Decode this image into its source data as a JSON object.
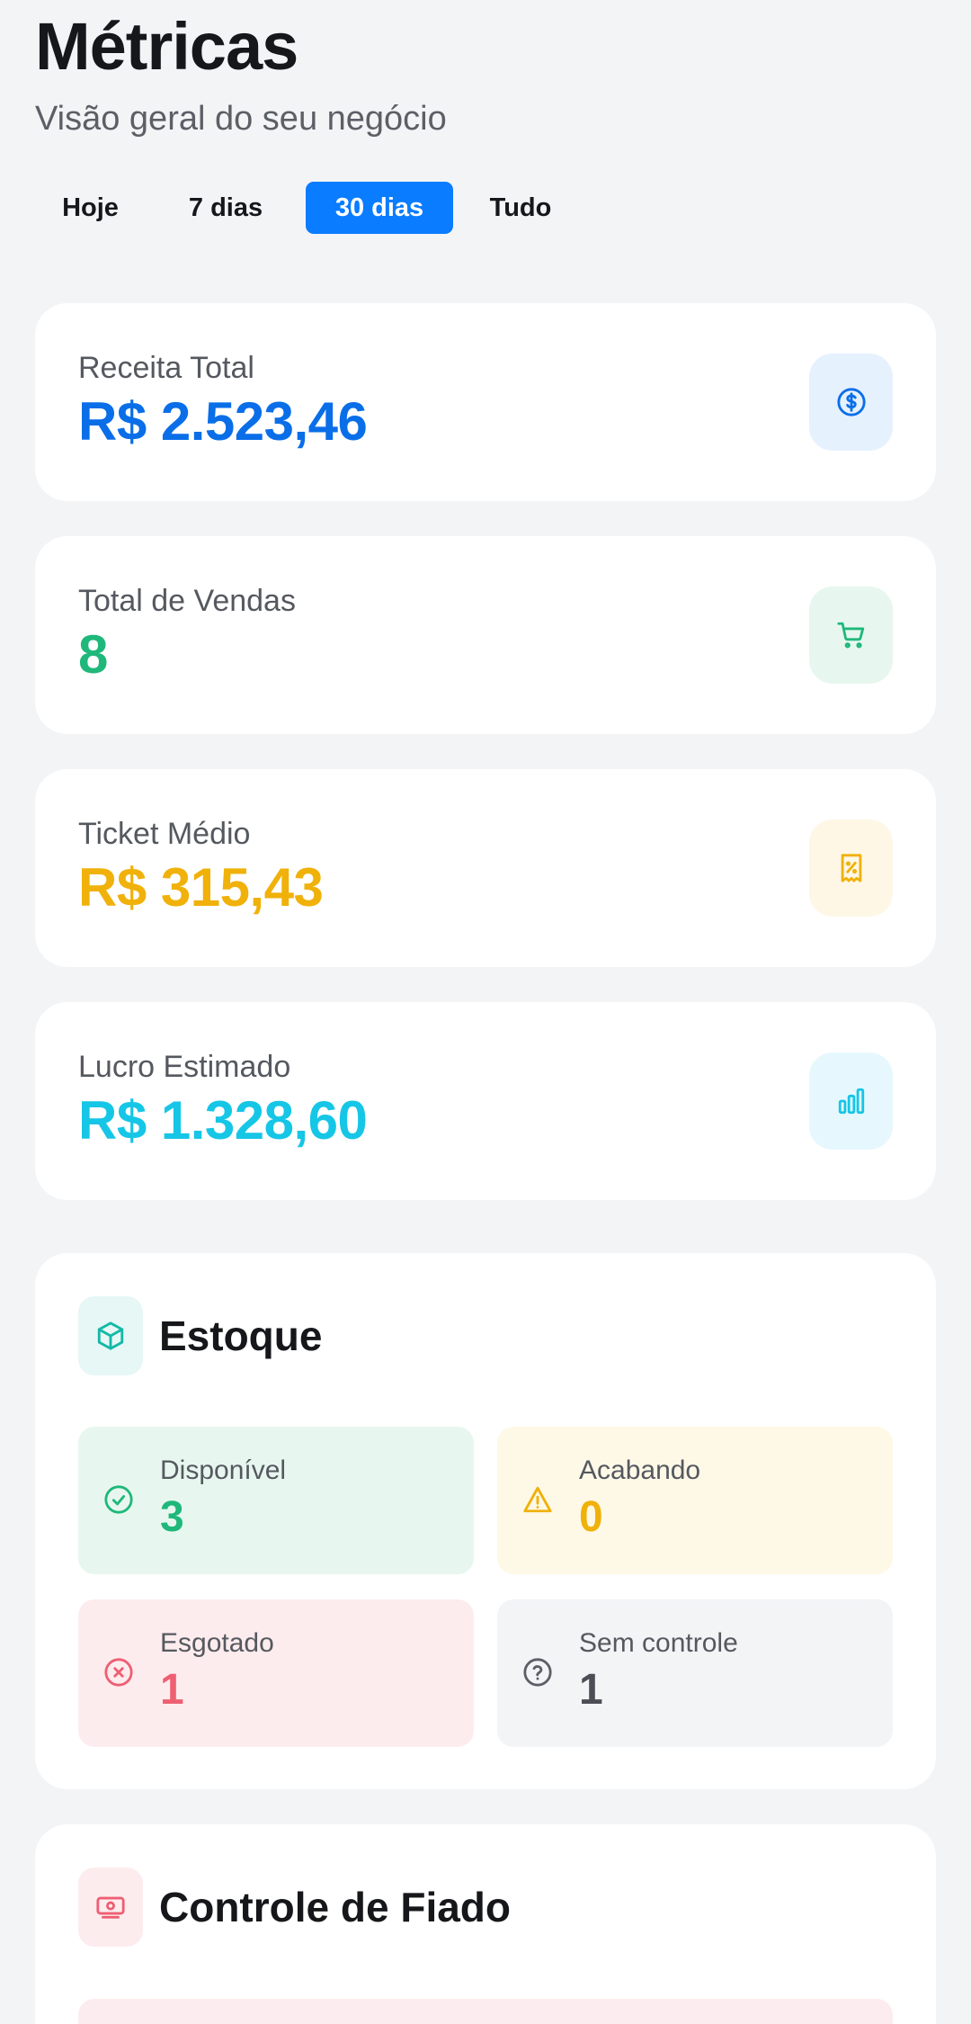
{
  "header": {
    "title": "Métricas",
    "subtitle": "Visão geral do seu negócio"
  },
  "period_tabs": [
    {
      "label": "Hoje",
      "active": false
    },
    {
      "label": "7 dias",
      "active": false
    },
    {
      "label": "30 dias",
      "active": true
    },
    {
      "label": "Tudo",
      "active": false
    }
  ],
  "metrics": [
    {
      "label": "Receita Total",
      "value": "R$ 2.523,46",
      "color": "#0a6ee8",
      "icon": "dollar-icon",
      "icon_bg": "#e6f1fe",
      "icon_color": "#0a6ee8"
    },
    {
      "label": "Total de Vendas",
      "value": "8",
      "color": "#1fb87a",
      "icon": "cart-icon",
      "icon_bg": "#e7f7ef",
      "icon_color": "#1fb87a"
    },
    {
      "label": "Ticket Médio",
      "value": "R$ 315,43",
      "color": "#f0b10a",
      "icon": "receipt-percent-icon",
      "icon_bg": "#fef7e6",
      "icon_color": "#f0b10a"
    },
    {
      "label": "Lucro Estimado",
      "value": "R$ 1.328,60",
      "color": "#16c6e6",
      "icon": "bar-chart-icon",
      "icon_bg": "#e6f8fd",
      "icon_color": "#16c6e6"
    }
  ],
  "stock": {
    "title": "Estoque",
    "icon": "box-icon",
    "tiles": [
      {
        "label": "Disponível",
        "value": "3",
        "color": "#1fb87a",
        "bg": "#e7f7ef",
        "icon": "check-circle-icon"
      },
      {
        "label": "Acabando",
        "value": "0",
        "color": "#f0b10a",
        "bg": "#fef8e7",
        "icon": "warning-icon"
      },
      {
        "label": "Esgotado",
        "value": "1",
        "color": "#ee5f72",
        "bg": "#fdecee",
        "icon": "x-circle-icon"
      },
      {
        "label": "Sem controle",
        "value": "1",
        "color": "#4b4f55",
        "bg": "#f3f4f6",
        "icon": "question-circle-icon"
      }
    ]
  },
  "fiado": {
    "title": "Controle de Fiado",
    "icon": "money-icon"
  }
}
